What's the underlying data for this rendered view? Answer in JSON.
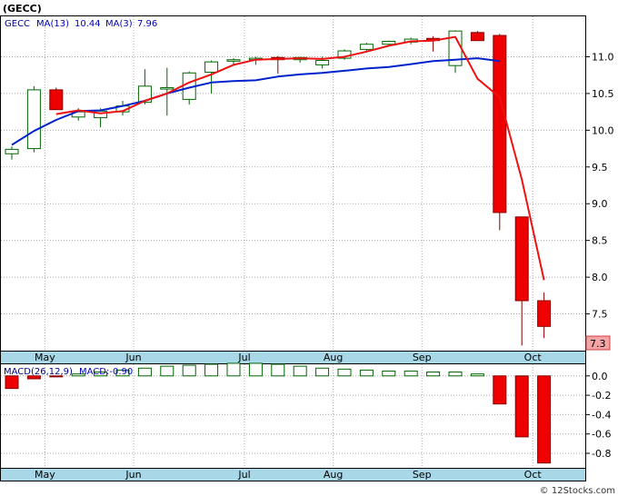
{
  "title": "(GECC)",
  "watermark": "© 12Stocks.com",
  "colors": {
    "up_fill": "#ffffff",
    "up_stroke": "#006600",
    "down_fill": "#ee0000",
    "down_stroke": "#880000",
    "ma13": "#0022cc",
    "ma3": "#ee1111",
    "grid": "#aaaaaa",
    "axis_band": "#a8d8e8",
    "price_badge": "#f4a4a4"
  },
  "price_panel": {
    "legend": {
      "symbol": "GECC",
      "ma13_label": "MA(13)",
      "ma13_value": "10.44",
      "ma3_label": "MA(3)",
      "ma3_value": "7.96"
    },
    "last_price_badge": "7.3"
  },
  "macd_panel": {
    "legend": {
      "params": "MACD(26,12,9)",
      "value_label": "MACD:-0.90"
    }
  },
  "x_axis_months": [
    "May",
    "Jun",
    "Jul",
    "Aug",
    "Sep",
    "Oct"
  ],
  "chart_data": [
    {
      "type": "candlestick",
      "title": "(GECC)",
      "ylim": [
        7.0,
        11.55
      ],
      "yticks": [
        "11.0",
        "10.5",
        "10.0",
        "9.5",
        "9.0",
        "8.5",
        "8.0",
        "7.5"
      ],
      "grid": true,
      "weeks": [
        {
          "month_tick": "",
          "open": 9.68,
          "high": 9.78,
          "low": 9.6,
          "close": 9.74
        },
        {
          "month_tick": "May",
          "open": 9.75,
          "high": 10.6,
          "low": 9.7,
          "close": 10.55
        },
        {
          "month_tick": "",
          "open": 10.55,
          "high": 10.58,
          "low": 10.28,
          "close": 10.28
        },
        {
          "month_tick": "",
          "open": 10.18,
          "high": 10.3,
          "low": 10.13,
          "close": 10.25
        },
        {
          "month_tick": "",
          "open": 10.17,
          "high": 10.3,
          "low": 10.04,
          "close": 10.26
        },
        {
          "month_tick": "Jun",
          "open": 10.25,
          "high": 10.4,
          "low": 10.2,
          "close": 10.33
        },
        {
          "month_tick": "",
          "open": 10.38,
          "high": 10.83,
          "low": 10.35,
          "close": 10.6
        },
        {
          "month_tick": "",
          "open": 10.56,
          "high": 10.85,
          "low": 10.2,
          "close": 10.58
        },
        {
          "month_tick": "",
          "open": 10.42,
          "high": 10.8,
          "low": 10.35,
          "close": 10.78
        },
        {
          "month_tick": "",
          "open": 10.79,
          "high": 10.95,
          "low": 10.5,
          "close": 10.93
        },
        {
          "month_tick": "Jul",
          "open": 10.94,
          "high": 10.98,
          "low": 10.9,
          "close": 10.96
        },
        {
          "month_tick": "",
          "open": 10.96,
          "high": 11.0,
          "low": 10.89,
          "close": 10.98
        },
        {
          "month_tick": "",
          "open": 10.99,
          "high": 11.01,
          "low": 10.77,
          "close": 10.96
        },
        {
          "month_tick": "",
          "open": 10.96,
          "high": 11.0,
          "low": 10.92,
          "close": 10.99
        },
        {
          "month_tick": "Aug",
          "open": 10.89,
          "high": 11.0,
          "low": 10.84,
          "close": 10.95
        },
        {
          "month_tick": "",
          "open": 10.98,
          "high": 11.1,
          "low": 10.96,
          "close": 11.08
        },
        {
          "month_tick": "",
          "open": 11.1,
          "high": 11.19,
          "low": 11.08,
          "close": 11.17
        },
        {
          "month_tick": "",
          "open": 11.17,
          "high": 11.22,
          "low": 11.15,
          "close": 11.21
        },
        {
          "month_tick": "Sep",
          "open": 11.2,
          "high": 11.26,
          "low": 11.17,
          "close": 11.24
        },
        {
          "month_tick": "",
          "open": 11.25,
          "high": 11.28,
          "low": 11.07,
          "close": 11.22
        },
        {
          "month_tick": "",
          "open": 10.88,
          "high": 11.36,
          "low": 10.78,
          "close": 11.35
        },
        {
          "month_tick": "",
          "open": 11.33,
          "high": 11.35,
          "low": 11.22,
          "close": 11.22
        },
        {
          "month_tick": "",
          "open": 11.29,
          "high": 11.31,
          "low": 8.64,
          "close": 8.88
        },
        {
          "month_tick": "Oct",
          "open": 8.82,
          "high": 8.82,
          "low": 7.07,
          "close": 7.68
        },
        {
          "month_tick": "",
          "open": 7.68,
          "high": 7.79,
          "low": 7.17,
          "close": 7.33
        }
      ],
      "series": [
        {
          "name": "MA(13)",
          "values": [
            9.8,
            9.99,
            10.14,
            10.26,
            10.27,
            10.33,
            10.4,
            10.5,
            10.58,
            10.65,
            10.67,
            10.68,
            10.73,
            10.76,
            10.78,
            10.81,
            10.84,
            10.86,
            10.9,
            10.94,
            10.96,
            10.98,
            10.94,
            null,
            null
          ]
        },
        {
          "name": "MA(3)",
          "values": [
            null,
            null,
            10.22,
            10.27,
            10.23,
            10.26,
            10.4,
            10.5,
            10.65,
            10.76,
            10.89,
            10.96,
            10.97,
            10.98,
            10.97,
            11.0,
            11.07,
            11.15,
            11.21,
            11.22,
            11.27,
            10.7,
            10.45,
            9.33,
            7.96
          ]
        }
      ]
    },
    {
      "type": "bar",
      "title": "MACD(26,12,9)",
      "ylim": [
        -0.95,
        0.12
      ],
      "yticks": [
        "0.0",
        "-0.2",
        "-0.4",
        "-0.6",
        "-0.8"
      ],
      "grid": true,
      "values": [
        -0.13,
        -0.03,
        -0.01,
        0.02,
        0.04,
        0.06,
        0.08,
        0.1,
        0.11,
        0.12,
        0.13,
        0.13,
        0.12,
        0.1,
        0.08,
        0.07,
        0.06,
        0.05,
        0.05,
        0.04,
        0.04,
        0.02,
        -0.29,
        -0.63,
        -0.9
      ]
    }
  ]
}
